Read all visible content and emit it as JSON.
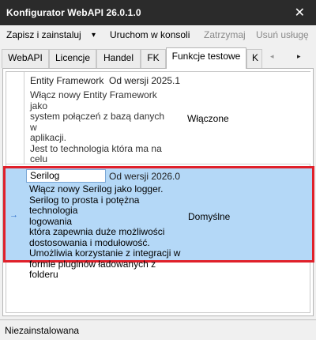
{
  "window": {
    "title": "Konfigurator WebAPI 26.0.1.0",
    "close_glyph": "✕"
  },
  "toolbar": {
    "items": [
      {
        "label": "Zapisz i zainstaluj",
        "enabled": true
      },
      {
        "label": "▾",
        "enabled": true
      },
      {
        "label": "Uruchom w konsoli",
        "enabled": true
      },
      {
        "label": "Zatrzymaj",
        "enabled": false
      },
      {
        "label": "Usuń usługę",
        "enabled": false
      }
    ]
  },
  "tabs": {
    "items": [
      {
        "label": "WebAPI"
      },
      {
        "label": "Licencje"
      },
      {
        "label": "Handel"
      },
      {
        "label": "FK"
      },
      {
        "label": "Funkcje testowe",
        "active": true
      },
      {
        "label": "K"
      }
    ],
    "scroll_left": "◂",
    "scroll_right": "▸"
  },
  "features": [
    {
      "name": "Entity Framework",
      "version": "Od wersji 2025.1",
      "description": "Włącz nowy Entity Framework jako\nsystem połączeń z bazą danych w\naplikacji.\nJest to technologia która ma na celu\npoprawę jakości, efektywności i\nbezpieczeństwa WebApi.\nhttps://learn.microsoft.com/en-us/ef/",
      "state": "Włączone"
    },
    {
      "name": "Serilog",
      "version": "Od wersji 2026.0",
      "description": "Włącz nowy Serilog jako logger.\nSerilog to prosta i potężna technologia\nlogowania\nktóra zapewnia duże możliwości\ndostosowania i modułowość.\nUmożliwia korzystanie z integracji w\nformie pluginów ładowanych z folderu",
      "state": "Domyślne",
      "row_marker": "→"
    }
  ],
  "status": {
    "text": "Niezainstalowana"
  }
}
